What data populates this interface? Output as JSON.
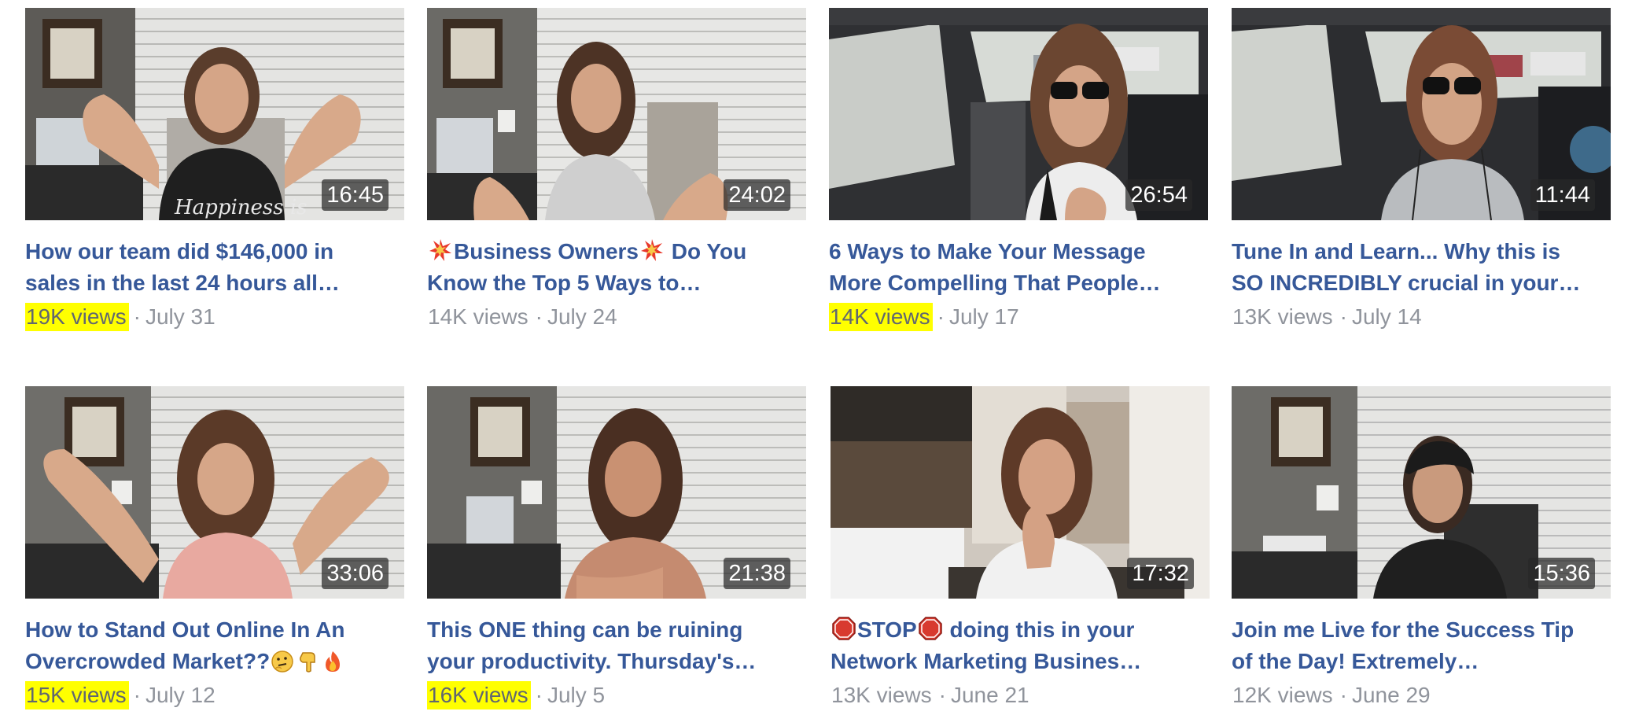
{
  "videos": [
    {
      "title_line1": "How our team did $146,000 in",
      "title_line2": "sales in the last 24 hours all…",
      "duration": "16:45",
      "views": "19K views",
      "date": "July 31",
      "views_highlighted": true,
      "shirt_text": "Happiness is"
    },
    {
      "title_pre": "",
      "title_main": "Business Owners",
      "title_post": " Do You",
      "title_line2": "Know the Top 5 Ways to…",
      "duration": "24:02",
      "views": "14K views",
      "date": "July 24",
      "views_highlighted": false,
      "emoji": "collision-icon"
    },
    {
      "title_line1": "6 Ways to Make Your Message",
      "title_line2": "More Compelling That People…",
      "duration": "26:54",
      "views": "14K views",
      "date": "July 17",
      "views_highlighted": true
    },
    {
      "title_line1": "Tune In and Learn... Why this is",
      "title_line2": "SO INCREDIBLY crucial in your…",
      "duration": "11:44",
      "views": "13K views",
      "date": "July 14",
      "views_highlighted": false
    },
    {
      "title_line1": "How to Stand Out Online In An",
      "title_line2": "Overcrowded Market??",
      "duration": "33:06",
      "views": "15K views",
      "date": "July 12",
      "views_highlighted": true,
      "emojis": [
        "thinking-face-icon",
        "point-down-icon",
        "fire-icon"
      ]
    },
    {
      "title_line1": "This ONE thing can be ruining",
      "title_line2": "your productivity. Thursday's…",
      "duration": "21:38",
      "views": "16K views",
      "date": "July 5",
      "views_highlighted": true
    },
    {
      "title_main": "STOP",
      "title_post": " doing this in your",
      "title_line2": "Network Marketing Busines…",
      "duration": "17:32",
      "views": "13K views",
      "date": "June 21",
      "views_highlighted": false,
      "emoji": "stop-sign-icon"
    },
    {
      "title_line1": "Join me Live for the Success Tip",
      "title_line2": "of the Day! Extremely…",
      "duration": "15:36",
      "views": "12K views",
      "date": "June 29",
      "views_highlighted": false
    }
  ],
  "separator": "·",
  "colors": {
    "title": "#365899",
    "meta": "#90949c",
    "highlight": "#ffff00",
    "duration_bg": "#282828"
  }
}
